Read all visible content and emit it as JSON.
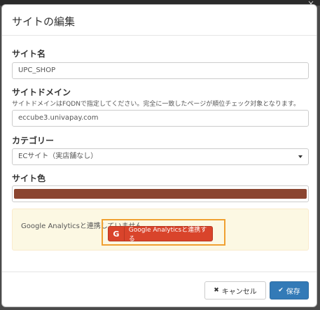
{
  "modal": {
    "title": "サイトの編集",
    "close_glyph": "×"
  },
  "form": {
    "site_name": {
      "label": "サイト名",
      "value": "UPC_SHOP"
    },
    "site_domain": {
      "label": "サイトドメイン",
      "help": "サイトドメインはFQDNで指定してください。完全に一致したページが順位チェック対象となります。",
      "value": "eccube3.univapay.com"
    },
    "category": {
      "label": "カテゴリー",
      "selected": "ECサイト（実店舗なし）"
    },
    "site_color": {
      "label": "サイト色",
      "color": "#8b4530"
    }
  },
  "google_analytics": {
    "message": "Google Analyticsと連携していません。",
    "button_icon": "G",
    "button_label": "Google Analyticsと連携する"
  },
  "footer": {
    "cancel_label": "キャンセル",
    "cancel_icon": "✖",
    "save_label": "保存",
    "save_icon": "✔"
  }
}
